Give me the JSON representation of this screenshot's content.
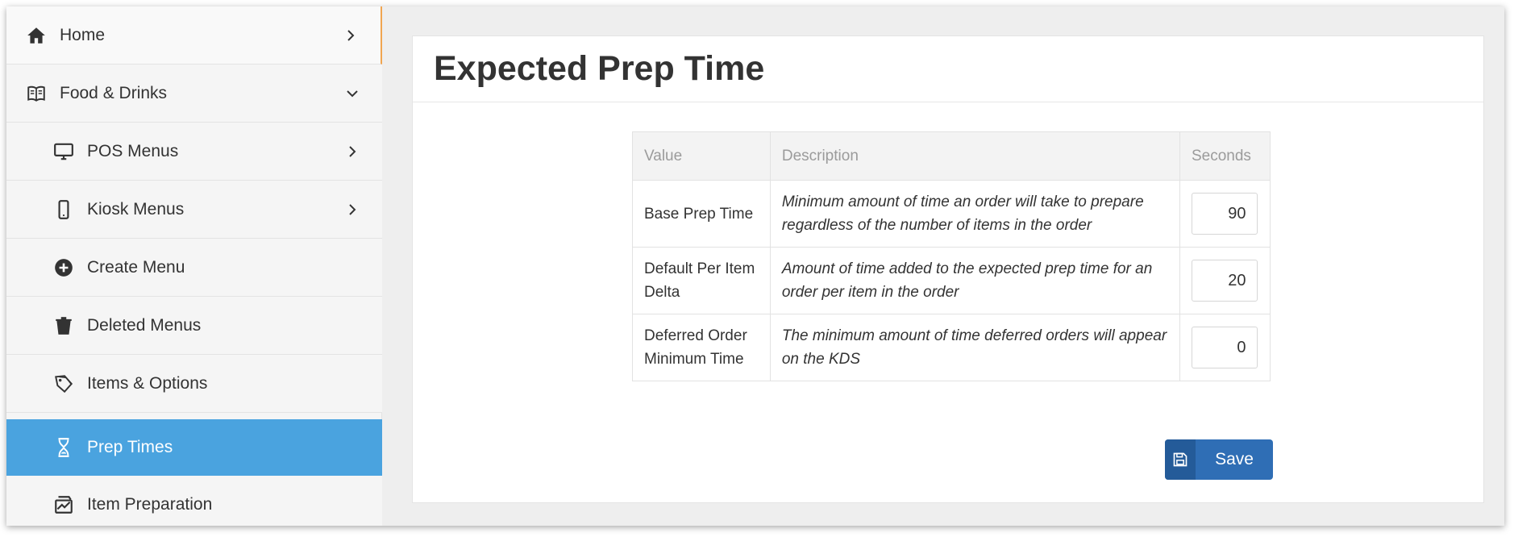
{
  "sidebar": {
    "items": [
      {
        "label": "Home",
        "icon": "home-icon"
      },
      {
        "label": "Food & Drinks",
        "icon": "book-icon"
      },
      {
        "label": "POS Menus",
        "icon": "desktop-icon"
      },
      {
        "label": "Kiosk Menus",
        "icon": "mobile-icon"
      },
      {
        "label": "Create Menu",
        "icon": "plus-circle-icon"
      },
      {
        "label": "Deleted Menus",
        "icon": "trash-icon"
      },
      {
        "label": "Items & Options",
        "icon": "tags-icon"
      },
      {
        "label": "Prep Times",
        "icon": "hourglass-icon"
      },
      {
        "label": "Item Preparation",
        "icon": "preparation-icon"
      }
    ],
    "active": "Prep Times"
  },
  "main": {
    "title": "Expected Prep Time",
    "table": {
      "headers": [
        "Value",
        "Description",
        "Seconds"
      ],
      "rows": [
        {
          "value": "Base Prep Time",
          "description": "Minimum amount of time an order will take to prepare regardless of the number of items in the order",
          "seconds": "90"
        },
        {
          "value": "Default Per Item Delta",
          "description": "Amount of time added to the expected prep time for an order per item in the order",
          "seconds": "20"
        },
        {
          "value": "Deferred Order Minimum Time",
          "description": "The minimum amount of time deferred orders will appear on the KDS",
          "seconds": "0"
        }
      ]
    },
    "save_label": "Save"
  },
  "colors": {
    "active_nav": "#4aa3df",
    "save_button": "#2f6eb5",
    "accent_border": "#f0a550"
  }
}
